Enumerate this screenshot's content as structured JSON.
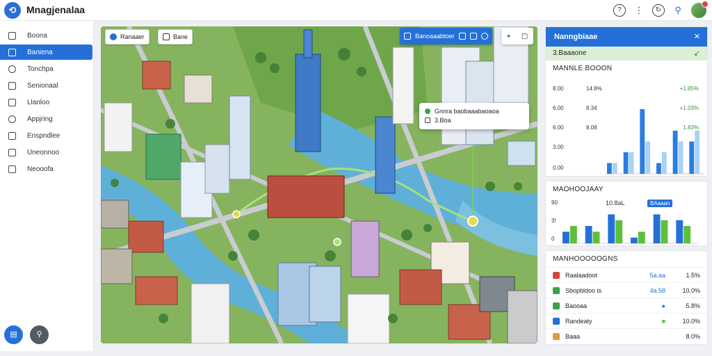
{
  "app": {
    "title": "Mnagjenalaa"
  },
  "sidebar": {
    "items": [
      {
        "label": "Boona",
        "icon": "home-icon"
      },
      {
        "label": "Baniena",
        "icon": "layers-icon"
      },
      {
        "label": "Tonchpa",
        "icon": "search-icon"
      },
      {
        "label": "Senionaal",
        "icon": "chart-icon"
      },
      {
        "label": "Llanloo",
        "icon": "folder-icon"
      },
      {
        "label": "Appjring",
        "icon": "location-icon"
      },
      {
        "label": "Enspndlee",
        "icon": "info-icon"
      },
      {
        "label": "Uneonnoo",
        "icon": "document-icon"
      },
      {
        "label": "Neooofa",
        "icon": "settings-icon"
      }
    ],
    "active_index": 1
  },
  "map": {
    "btn1": "Ranaaer",
    "btn2": "Bane",
    "toolbar_label": "Banoaaabtoer",
    "popup_line1": "Gnnra baobaaabaoaoa",
    "popup_line2": "3.Boa"
  },
  "panel": {
    "header": "Nanngbiaae",
    "strip_label": "3.Baaaone",
    "section1_title": "MANNLE BOOON",
    "section1_rows": [
      {
        "label": "8.00",
        "value": "14.8%",
        "change": "+1.85%"
      },
      {
        "label": "6.00",
        "value": "8.34",
        "change": "+1.03%"
      },
      {
        "label": "6.00",
        "value": "8.08",
        "change": "1.83%"
      }
    ],
    "section1_ticks": [
      "3.00",
      "0.00"
    ],
    "section2_title": "MAOHOOJAAY",
    "section2_value": "10.8aL",
    "section2_badge": "BAaaan",
    "section2_ticks": [
      "90",
      "3!",
      "0"
    ],
    "section3_title": "MANHOOOOOGNS",
    "indicators": [
      {
        "name": "Raalaadoot",
        "v1": "5a.aa",
        "v2": "1.5%",
        "color": "#d6453a"
      },
      {
        "name": "Sbopbldoo is",
        "v1": "4a.58",
        "v2": "10.0%",
        "color": "#3aa34a"
      },
      {
        "name": "Baooaa",
        "v1": "●",
        "v2": "5.8%",
        "color": "#3aa34a"
      },
      {
        "name": "Randeaty",
        "v1": "■",
        "v2": "10.0%",
        "color": "#2470d8"
      },
      {
        "name": "Baaa",
        "v1": "",
        "v2": "8.0%",
        "color": "#e49a3a"
      }
    ]
  },
  "chart_data": [
    {
      "type": "bar",
      "series": [
        {
          "color": "#2a7de1",
          "values": [
            1,
            2,
            6,
            1,
            4,
            3
          ]
        },
        {
          "color": "#a9d1f5",
          "values": [
            1,
            2,
            3,
            2,
            3,
            4
          ]
        }
      ],
      "ylim": [
        0,
        8
      ]
    },
    {
      "type": "bar",
      "series": [
        {
          "color": "#2470d8",
          "values": [
            2,
            3,
            5,
            1,
            5,
            4
          ]
        },
        {
          "color": "#5cbf3c",
          "values": [
            3,
            2,
            4,
            2,
            4,
            3
          ]
        }
      ],
      "ylim": [
        0,
        6
      ]
    }
  ]
}
